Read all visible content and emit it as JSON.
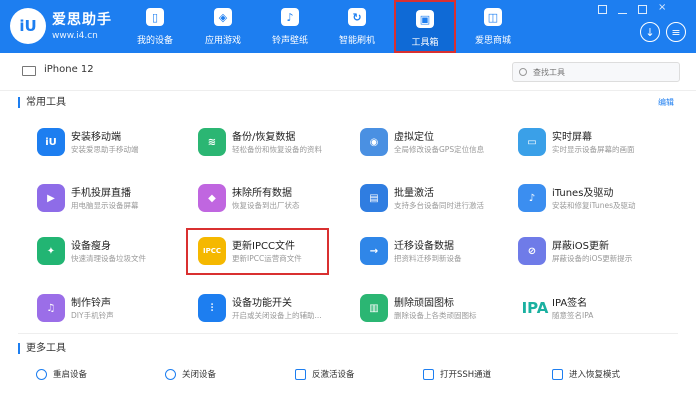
{
  "header": {
    "logo_text": "iU",
    "brand_name": "爱思助手",
    "brand_url": "www.i4.cn",
    "tabs": [
      {
        "label": "我的设备",
        "icon": "phone-icon"
      },
      {
        "label": "应用游戏",
        "icon": "cube-icon"
      },
      {
        "label": "铃声壁纸",
        "icon": "music-icon"
      },
      {
        "label": "智能刷机",
        "icon": "refresh-icon"
      },
      {
        "label": "工具箱",
        "icon": "toolbox-icon",
        "active": true
      },
      {
        "label": "爱思商城",
        "icon": "shop-icon"
      }
    ],
    "download_glyph": "↓",
    "menu_glyph": "≡"
  },
  "device": {
    "name": "iPhone 12"
  },
  "search": {
    "placeholder": "查找工具"
  },
  "sections": {
    "common_title": "常用工具",
    "edit_label": "编辑",
    "more_title": "更多工具"
  },
  "tools": [
    {
      "name": "安装移动端",
      "desc": "安装爱思助手移动端",
      "color": "#1d7ef0",
      "glyph": "iU"
    },
    {
      "name": "备份/恢复数据",
      "desc": "轻松备份和恢复设备的资料",
      "color": "#2bb673",
      "glyph": "≋"
    },
    {
      "name": "虚拟定位",
      "desc": "全局修改设备GPS定位信息",
      "color": "#4a90e2",
      "glyph": "◉"
    },
    {
      "name": "实时屏幕",
      "desc": "实时显示设备屏幕的画面",
      "color": "#3aa0e8",
      "glyph": "▭"
    },
    {
      "name": "手机投屏直播",
      "desc": "用电脑显示设备屏幕",
      "color": "#8e6ce8",
      "glyph": "▶"
    },
    {
      "name": "抹除所有数据",
      "desc": "恢复设备到出厂状态",
      "color": "#c066e0",
      "glyph": "◆"
    },
    {
      "name": "批量激活",
      "desc": "支持多台设备同时进行激活",
      "color": "#2f7de1",
      "glyph": "▤"
    },
    {
      "name": "iTunes及驱动",
      "desc": "安装和修复iTunes及驱动",
      "color": "#3b8ef0",
      "glyph": "♪"
    },
    {
      "name": "设备瘦身",
      "desc": "快速清理设备垃圾文件",
      "color": "#22b573",
      "glyph": "✦"
    },
    {
      "name": "更新IPCC文件",
      "desc": "更新IPCC运营商文件",
      "color": "#f5b800",
      "glyph": "IPCC"
    },
    {
      "name": "迁移设备数据",
      "desc": "把资料迁移到新设备",
      "color": "#2f86e8",
      "glyph": "→"
    },
    {
      "name": "屏蔽iOS更新",
      "desc": "屏蔽设备的iOS更新提示",
      "color": "#6f7be8",
      "glyph": "⊘"
    },
    {
      "name": "制作铃声",
      "desc": "DIY手机铃声",
      "color": "#9b6ee8",
      "glyph": "♫"
    },
    {
      "name": "设备功能开关",
      "desc": "开启或关闭设备上的辅助...",
      "color": "#1d7ef0",
      "glyph": "⫶"
    },
    {
      "name": "删除顽固图标",
      "desc": "删除设备上各类顽固图标",
      "color": "#2bb673",
      "glyph": "▥"
    },
    {
      "name": "IPA签名",
      "desc": "随意签名IPA",
      "color": "#ffffff",
      "glyph": "IPA"
    }
  ],
  "more_tools": [
    {
      "label": "重启设备"
    },
    {
      "label": "关闭设备"
    },
    {
      "label": "反激活设备"
    },
    {
      "label": "打开SSH通道"
    },
    {
      "label": "进入恢复模式"
    }
  ]
}
